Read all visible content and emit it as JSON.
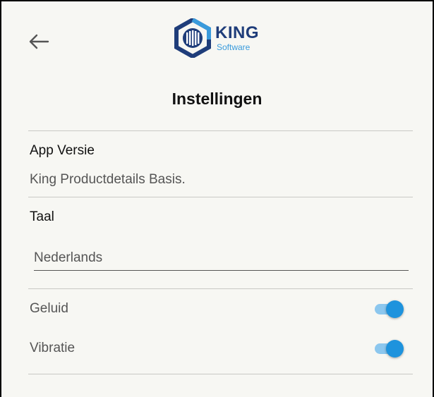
{
  "header": {
    "back_icon": "arrow-left-icon",
    "logo": {
      "word": "KING",
      "sub": "Software",
      "icon": "king-hexagon-logo-icon",
      "colors": {
        "dark": "#1f3d7a",
        "light": "#3a9bdc"
      }
    }
  },
  "title": "Instellingen",
  "app_version": {
    "label": "App Versie",
    "value": "King Productdetails Basis."
  },
  "language": {
    "label": "Taal",
    "value": "Nederlands"
  },
  "toggles": [
    {
      "label": "Geluid",
      "on": true
    },
    {
      "label": "Vibratie",
      "on": true
    }
  ],
  "colors": {
    "accent": "#1e93dd",
    "accent_track": "#8cc7ee",
    "background": "#f7f7f3"
  }
}
